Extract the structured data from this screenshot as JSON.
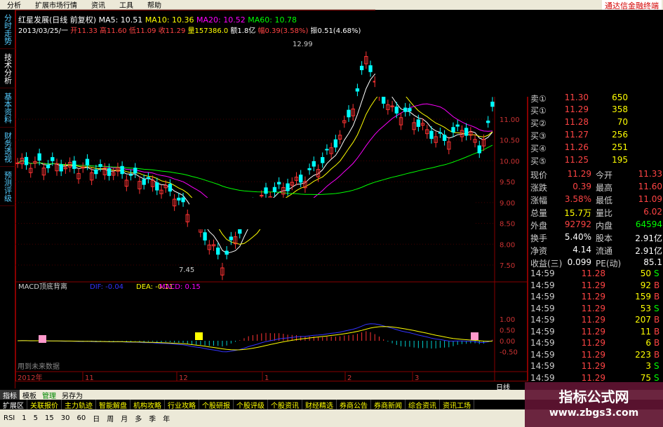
{
  "menu": [
    "分析",
    "扩展市场行情",
    "资讯",
    "工具",
    "帮助"
  ],
  "brand": "通达信金融终端",
  "left_tabs": [
    "分时走势",
    "技术分析",
    "基本资料",
    "财务透视",
    "预测评级"
  ],
  "header": {
    "stock": "红星发展(日线 前复权)",
    "ma5": "MA5: 10.51",
    "ma10": "MA10: 10.36",
    "ma20": "MA20: 10.52",
    "ma60": "MA60: 10.78",
    "date": "2013/03/25/一",
    "open": "开11.33",
    "high": "高11.60",
    "low": "低11.09",
    "close": "收11.29",
    "vol": "量157386.0",
    "amount": "额1.8亿",
    "change": "幅0.39(3.58%)",
    "amp": "振0.51(4.68%)"
  },
  "price_axis": [
    "11.00",
    "10.50",
    "10.00",
    "9.50",
    "9.00",
    "8.50",
    "8.00",
    "7.50"
  ],
  "annotations": {
    "high": "12.99",
    "low": "7.45"
  },
  "indicator": {
    "title": "MACD顶底背离",
    "dif": "DIF: -0.04",
    "dea": "DEA: -0.11",
    "macd": "MACD: 0.15",
    "axis": [
      "1.00",
      "0.50",
      "0.00",
      "-0.50"
    ],
    "note": "用到未来数据"
  },
  "time_axis": [
    "2012年",
    "11",
    "12",
    "1",
    "2",
    "3"
  ],
  "axis_label": "日线",
  "quotes": {
    "ask": [
      {
        "label": "卖①",
        "price": "11.30",
        "vol": "650"
      }
    ],
    "bid": [
      {
        "label": "买①",
        "price": "11.29",
        "vol": "358"
      },
      {
        "label": "买②",
        "price": "11.28",
        "vol": "70"
      },
      {
        "label": "买③",
        "price": "11.27",
        "vol": "256"
      },
      {
        "label": "买④",
        "price": "11.26",
        "vol": "251"
      },
      {
        "label": "买⑤",
        "price": "11.25",
        "vol": "195"
      }
    ]
  },
  "stats": [
    {
      "l1": "现价",
      "v1": "11.29",
      "l2": "今开",
      "v2": "11.33",
      "c1": "red",
      "c2": "red"
    },
    {
      "l1": "涨跌",
      "v1": "0.39",
      "l2": "最高",
      "v2": "11.60",
      "c1": "red",
      "c2": "red"
    },
    {
      "l1": "涨幅",
      "v1": "3.58%",
      "l2": "最低",
      "v2": "11.09",
      "c1": "red",
      "c2": "red"
    },
    {
      "l1": "总量",
      "v1": "15.7万",
      "l2": "量比",
      "v2": "6.02",
      "c1": "yellow",
      "c2": "red"
    },
    {
      "l1": "外盘",
      "v1": "92792",
      "l2": "内盘",
      "v2": "64594",
      "c1": "red",
      "c2": "green"
    },
    {
      "l1": "换手",
      "v1": "5.40%",
      "l2": "股本",
      "v2": "2.91亿",
      "c1": "white",
      "c2": "white"
    },
    {
      "l1": "净资",
      "v1": "4.14",
      "l2": "流通",
      "v2": "2.91亿",
      "c1": "white",
      "c2": "white"
    },
    {
      "l1": "收益(三)",
      "v1": "0.099",
      "l2": "PE(动)",
      "v2": "85.1",
      "c1": "white",
      "c2": "white"
    }
  ],
  "ticks": [
    {
      "time": "14:59",
      "price": "11.28",
      "vol": "50",
      "bs": "S"
    },
    {
      "time": "14:59",
      "price": "11.29",
      "vol": "92",
      "bs": "B"
    },
    {
      "time": "14:59",
      "price": "11.29",
      "vol": "159",
      "bs": "B"
    },
    {
      "time": "14:59",
      "price": "11.29",
      "vol": "53",
      "bs": "S"
    },
    {
      "time": "14:59",
      "price": "11.29",
      "vol": "207",
      "bs": "B"
    },
    {
      "time": "14:59",
      "price": "11.29",
      "vol": "11",
      "bs": "B"
    },
    {
      "time": "14:59",
      "price": "11.29",
      "vol": "6",
      "bs": "B"
    },
    {
      "time": "14:59",
      "price": "11.29",
      "vol": "223",
      "bs": "B"
    },
    {
      "time": "14:59",
      "price": "11.29",
      "vol": "3",
      "bs": "S"
    },
    {
      "time": "14:59",
      "price": "11.29",
      "vol": "75",
      "bs": "S"
    }
  ],
  "bottom_tabs": [
    "指标",
    "模板",
    "管理",
    "另存为"
  ],
  "bottom_links": [
    "扩展区",
    "关联报价",
    "主力轨迹",
    "智能解盘",
    "机构攻略",
    "行业攻略",
    "个股研报",
    "个股评级",
    "个股资讯",
    "财经精选",
    "券商公告",
    "券商新闻",
    "综合资讯",
    "资讯工场"
  ],
  "toolbar": [
    "RSI",
    "1",
    "5",
    "15",
    "30",
    "60",
    "日",
    "周",
    "月",
    "多",
    "季",
    "年"
  ],
  "watermark": {
    "line1": "指标公式网",
    "line2": "www.zbgs3.com"
  },
  "colors": {
    "ma5": "#ffffff",
    "ma10": "#ffff00",
    "ma20": "#ff00ff",
    "ma60": "#00ff00",
    "up": "#ff3333",
    "down": "#00ffff"
  }
}
